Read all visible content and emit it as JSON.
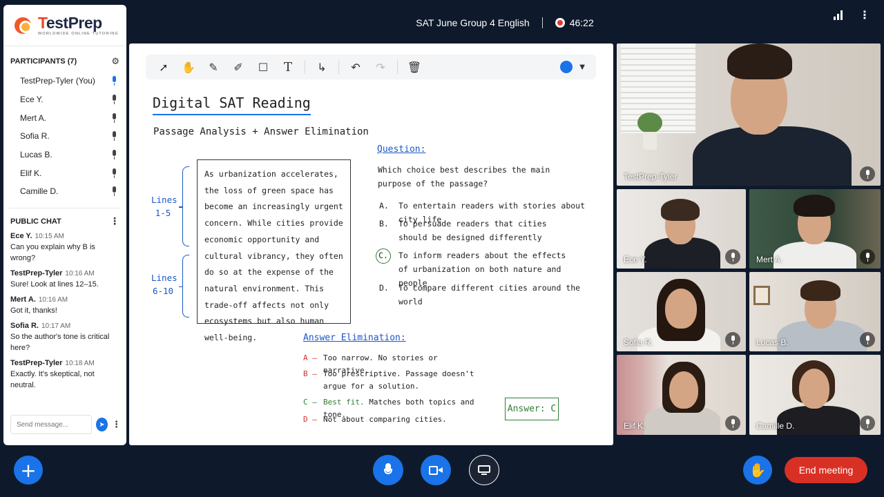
{
  "brand": {
    "name_part1": "T",
    "name_part2": "estPrep",
    "tagline": "WORLDWIDE ONLINE TUTORING"
  },
  "meeting": {
    "title": "SAT June Group 4 English",
    "timer": "46:22"
  },
  "participants": {
    "header": "PARTICIPANTS (7)",
    "list": [
      {
        "name": "TestPrep-Tyler (You)",
        "mic": "active"
      },
      {
        "name": "Ece Y.",
        "mic": "on"
      },
      {
        "name": "Mert A.",
        "mic": "on"
      },
      {
        "name": "Sofia R.",
        "mic": "on"
      },
      {
        "name": "Lucas B.",
        "mic": "on"
      },
      {
        "name": "Elif K.",
        "mic": "on"
      },
      {
        "name": "Camille D.",
        "mic": "on"
      }
    ]
  },
  "chat": {
    "header": "PUBLIC CHAT",
    "messages": [
      {
        "author": "Ece Y.",
        "time": "10:15 AM",
        "text": "Can you explain why B is wrong?"
      },
      {
        "author": "TestPrep-Tyler",
        "time": "10:16 AM",
        "text": "Sure! Look at lines 12–15."
      },
      {
        "author": "Mert A.",
        "time": "10:16 AM",
        "text": "Got it, thanks!"
      },
      {
        "author": "Sofia R.",
        "time": "10:17 AM",
        "text": "So the author's tone is critical here?"
      },
      {
        "author": "TestPrep-Tyler",
        "time": "10:18 AM",
        "text": "Exactly. It's skeptical, not neutral."
      }
    ],
    "input_placeholder": "Send message..."
  },
  "whiteboard": {
    "title": "Digital SAT Reading",
    "subtitle": "Passage Analysis + Answer Elimination",
    "lines_a": [
      "Lines",
      "1-5"
    ],
    "lines_b": [
      "Lines",
      "6-10"
    ],
    "passage": "As urbanization accelerates, the loss of green space has become an increasingly urgent concern. While cities provide economic opportunity and cultural vibrancy, they often do so at the expense of the natural environment. This trade-off affects not only ecosystems but also human well-being.",
    "question_label": "Question:",
    "question": "Which choice best describes the main purpose of the passage?",
    "options": [
      {
        "letter": "A.",
        "text": "To entertain readers with stories about city life"
      },
      {
        "letter": "B.",
        "text": "To persuade readers that cities should be designed differently"
      },
      {
        "letter": "C.",
        "text": "To inform readers about the effects of urbanization on both nature and people"
      },
      {
        "letter": "D.",
        "text": "To compare different cities around the world"
      }
    ],
    "elimination_label": "Answer Elimination:",
    "elimination": [
      {
        "letter": "A –",
        "text": "Too narrow. No stories or narrative."
      },
      {
        "letter": "B –",
        "text": "Too prescriptive. Passage doesn't argue for a solution."
      },
      {
        "letter": "C –",
        "highlight": "Best fit.",
        "text": " Matches both topics and tone."
      },
      {
        "letter": "D –",
        "text": "Not about comparing cities."
      }
    ],
    "answer": "Answer: C",
    "pen_color": "#1a73e8"
  },
  "videos": [
    {
      "name": "TestPrep-Tyler"
    },
    {
      "name": "Ece Y."
    },
    {
      "name": "Mert A."
    },
    {
      "name": "Sofia R."
    },
    {
      "name": "Lucas B."
    },
    {
      "name": "Elif K."
    },
    {
      "name": "Camille D."
    }
  ],
  "controls": {
    "end_label": "End meeting"
  },
  "colors": {
    "accent": "#1a73e8",
    "danger": "#d93025",
    "background": "#0e1a2b"
  }
}
